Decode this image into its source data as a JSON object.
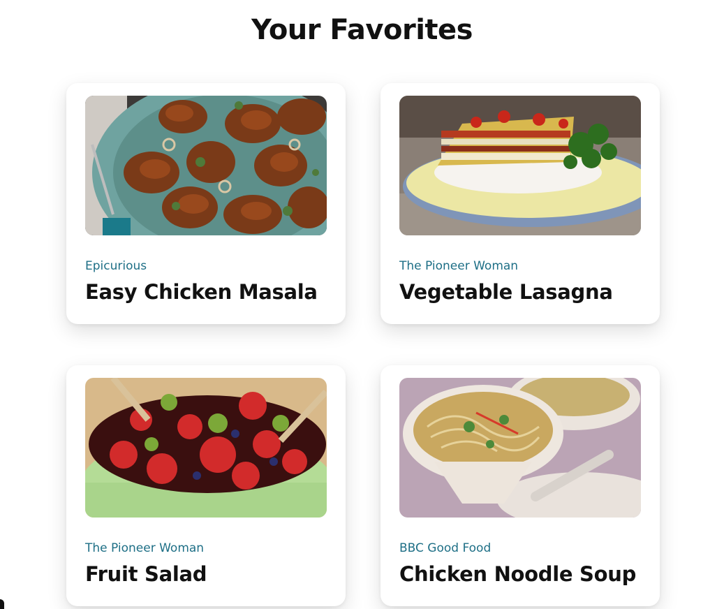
{
  "page": {
    "title": "Your Favorites"
  },
  "colors": {
    "source_text": "#1e6f86",
    "title_text": "#111111",
    "card_background": "#ffffff"
  },
  "recipes": [
    {
      "source": "Epicurious",
      "title": "Easy Chicken Masala",
      "image": "chicken-masala-photo"
    },
    {
      "source": "The Pioneer Woman",
      "title": "Vegetable Lasagna",
      "image": "vegetable-lasagna-photo"
    },
    {
      "source": "The Pioneer Woman",
      "title": "Fruit Salad",
      "image": "fruit-salad-photo"
    },
    {
      "source": "BBC Good Food",
      "title": "Chicken Noodle Soup",
      "image": "chicken-noodle-soup-photo"
    }
  ]
}
